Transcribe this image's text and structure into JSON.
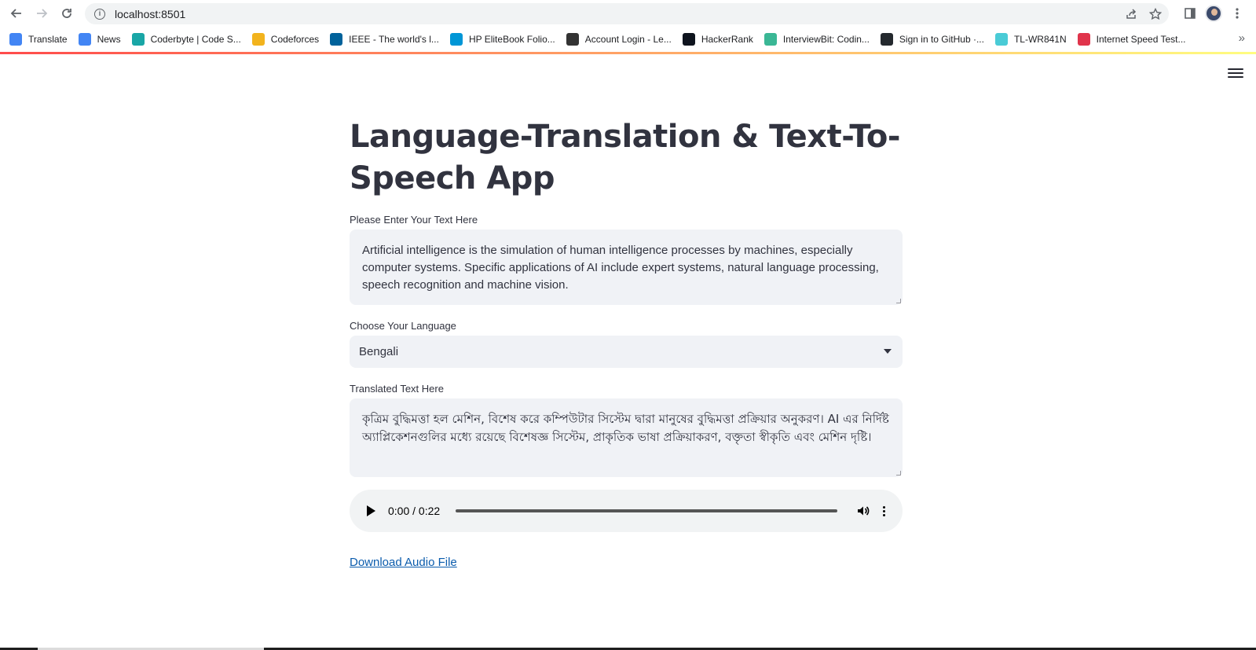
{
  "browser": {
    "url": "localhost:8501",
    "bookmarks": [
      {
        "label": "Translate",
        "icon": "google-translate-icon",
        "color": "#4285f4"
      },
      {
        "label": "News",
        "icon": "google-news-icon",
        "color": "#4285f4"
      },
      {
        "label": "Coderbyte | Code S...",
        "icon": "coderbyte-icon",
        "color": "#19a6a6"
      },
      {
        "label": "Codeforces",
        "icon": "codeforces-icon",
        "color": "#f2b31d"
      },
      {
        "label": "IEEE - The world's l...",
        "icon": "ieee-icon",
        "color": "#00629b"
      },
      {
        "label": "HP EliteBook Folio...",
        "icon": "hp-icon",
        "color": "#0096d6"
      },
      {
        "label": "Account Login - Le...",
        "icon": "lenovo-icon",
        "color": "#333333"
      },
      {
        "label": "HackerRank",
        "icon": "hackerrank-icon",
        "color": "#0e141e"
      },
      {
        "label": "InterviewBit: Codin...",
        "icon": "interviewbit-icon",
        "color": "#3ab795"
      },
      {
        "label": "Sign in to GitHub ·...",
        "icon": "github-icon",
        "color": "#24292e"
      },
      {
        "label": "TL-WR841N",
        "icon": "tplink-icon",
        "color": "#4acbd6"
      },
      {
        "label": "Internet Speed Test...",
        "icon": "speedtest-icon",
        "color": "#e0344b"
      }
    ],
    "more_bookmarks": "»"
  },
  "app": {
    "title": "Language-Translation & Text-To-Speech App",
    "input_label": "Please Enter Your Text Here",
    "input_text": "Artificial intelligence is the simulation of human intelligence processes by machines, especially computer systems. Specific applications of AI include expert systems, natural language processing, speech recognition and machine vision.",
    "language_label": "Choose Your Language",
    "language_selected": "Bengali",
    "output_label": "Translated Text Here",
    "output_text": "কৃত্রিম বুদ্ধিমত্তা হল মেশিন, বিশেষ করে কম্পিউটার সিস্টেম দ্বারা মানুষের বুদ্ধিমত্তা প্রক্রিয়ার অনুকরণ। AI এর নির্দিষ্ট অ্যাপ্লিকেশনগুলির মধ্যে রয়েছে বিশেষজ্ঞ সিস্টেম, প্রাকৃতিক ভাষা প্রক্রিয়াকরণ, বক্তৃতা স্বীকৃতি এবং মেশিন দৃষ্টি।",
    "audio_time": "0:00 / 0:22",
    "download_label": "Download Audio File"
  },
  "colors": {
    "accent_gradient_start": "#ff4b4b",
    "accent_gradient_end": "#fffd80",
    "input_background": "#f0f2f6",
    "text": "#31333f",
    "link": "#0b5cad"
  }
}
